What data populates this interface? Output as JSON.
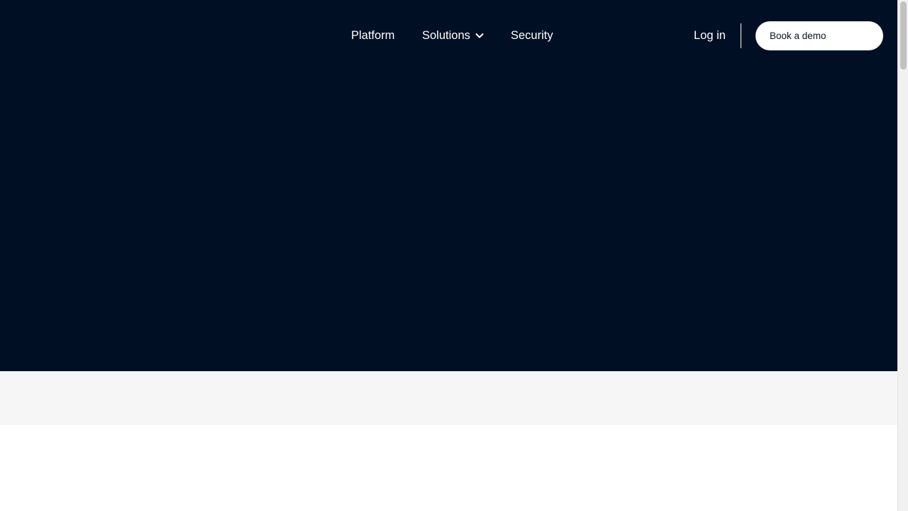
{
  "nav": {
    "links": [
      {
        "label": "Platform"
      },
      {
        "label": "Solutions",
        "icon": "chevron-down-icon"
      },
      {
        "label": "Security"
      }
    ],
    "login_label": "Log in",
    "cta_label": "Book a demo"
  },
  "colors": {
    "hero_background": "#000f24",
    "band_background": "#f6f6f6",
    "page_background": "#ffffff",
    "nav_text": "#ffffff",
    "cta_background": "#ffffff",
    "cta_text": "#0b1220"
  }
}
